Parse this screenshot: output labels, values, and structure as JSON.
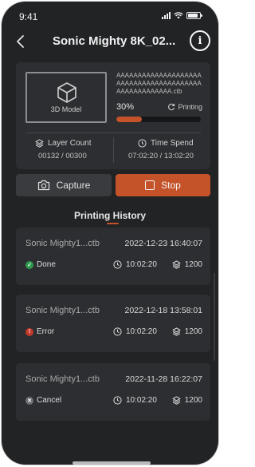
{
  "status_bar": {
    "time": "9:41"
  },
  "header": {
    "title": "Sonic Mighty 8K_02...",
    "info_glyph": "i"
  },
  "printer": {
    "model_label": "3D Model",
    "file_name": "AAAAAAAAAAAAAAAAAAAAAAAAAAAAAAAAAAAAAAAAAAAAAAAAAAAAA.ctb",
    "progress_text": "30%",
    "progress_value": 0.3,
    "state": "Printing",
    "layer_label": "Layer Count",
    "layer_value": "00132 / 00300",
    "time_label": "Time Spend",
    "time_value": "07:02:20 / 13:02:20",
    "accent": "#c4532a"
  },
  "buttons": {
    "capture": "Capture",
    "stop": "Stop"
  },
  "history": {
    "title": "Printing History",
    "items": [
      {
        "name": "Sonic Mighty1...ctb",
        "date": "2022-12-23 16:40:07",
        "status": "Done",
        "status_color": "#2e9a4e",
        "status_icon": "check-circle-icon",
        "duration": "10:02:20",
        "layers": "1200"
      },
      {
        "name": "Sonic Mighty1...ctb",
        "date": "2022-12-18 13:58:01",
        "status": "Error",
        "status_color": "#c0392b",
        "status_icon": "warning-circle-icon",
        "duration": "10:02:20",
        "layers": "1200"
      },
      {
        "name": "Sonic Mighty1...ctb",
        "date": "2022-11-28 16:22:07",
        "status": "Cancel",
        "status_color": "#6e6f72",
        "status_icon": "cancel-circle-icon",
        "duration": "10:02:20",
        "layers": "1200"
      }
    ]
  }
}
